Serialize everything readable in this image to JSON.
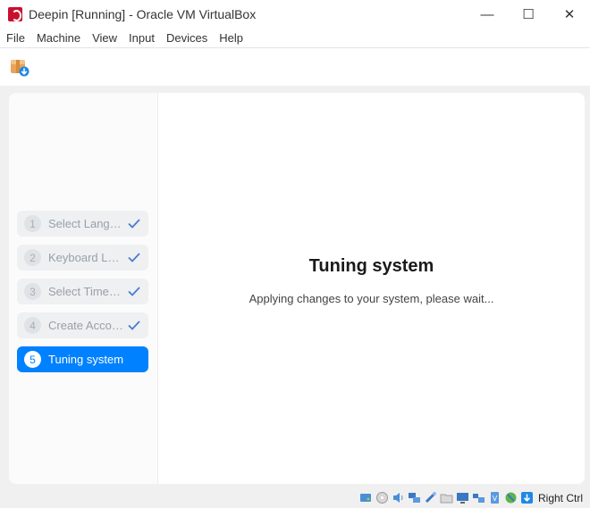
{
  "window": {
    "title": "Deepin [Running] - Oracle VM VirtualBox",
    "minimize": "—",
    "maximize": "☐",
    "close": "✕"
  },
  "menu": [
    "File",
    "Machine",
    "View",
    "Input",
    "Devices",
    "Help"
  ],
  "steps": [
    {
      "num": "1",
      "label": "Select Language",
      "done": true
    },
    {
      "num": "2",
      "label": "Keyboard Layout",
      "done": true
    },
    {
      "num": "3",
      "label": "Select Timezone",
      "done": true
    },
    {
      "num": "4",
      "label": "Create Account",
      "done": true
    },
    {
      "num": "5",
      "label": "Tuning system",
      "done": false
    }
  ],
  "main": {
    "title": "Tuning system",
    "subtitle": "Applying changes to your system, please wait..."
  },
  "statusbar": {
    "host_key": "Right Ctrl",
    "icons": [
      "hard-disk-icon",
      "optical-drive-icon",
      "audio-icon",
      "network-icon",
      "usb-icon",
      "shared-folders-icon",
      "display-icon",
      "video-capture-icon",
      "recording-icon",
      "cpu-icon",
      "mouse-integration-icon",
      "keyboard-capture-icon"
    ]
  },
  "colors": {
    "accent": "#0081ff",
    "step_inactive_bg": "#eef0f2"
  }
}
